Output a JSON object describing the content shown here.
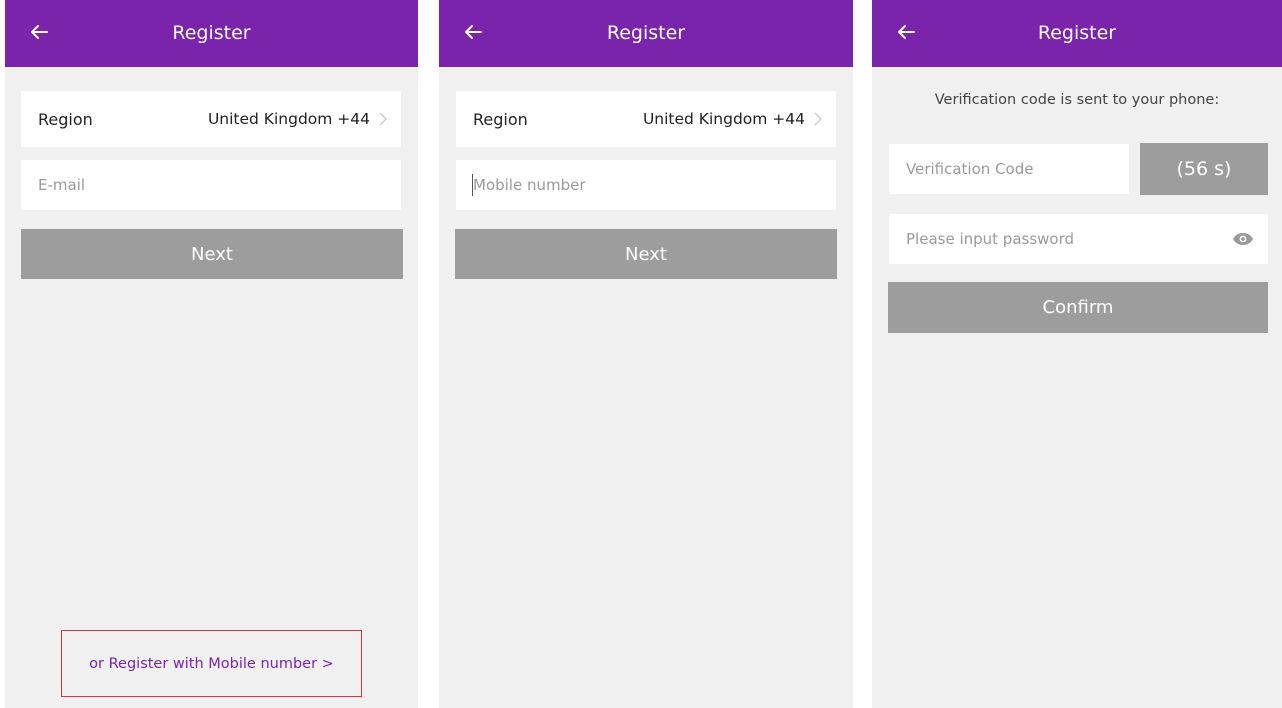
{
  "colors": {
    "appbar": "#7a23ab",
    "background": "#f0f0f0",
    "button_disabled": "#9d9d9d",
    "link": "#7a23ab",
    "highlight_border": "#d6343d"
  },
  "icons": {
    "back": "arrow-left-icon",
    "chevron": "chevron-right-icon",
    "password_toggle": "eye-icon"
  },
  "screens": [
    {
      "title": "Register",
      "region": {
        "label": "Region",
        "value": "United Kingdom +44"
      },
      "email": {
        "placeholder": "E-mail"
      },
      "next_label": "Next",
      "alt_link": "or Register with Mobile number >"
    },
    {
      "title": "Register",
      "region": {
        "label": "Region",
        "value": "United Kingdom +44"
      },
      "mobile": {
        "placeholder": "Mobile number"
      },
      "next_label": "Next"
    },
    {
      "title": "Register",
      "message": "Verification code is sent to your phone:",
      "code": {
        "placeholder": "Verification Code"
      },
      "resend_countdown": "(56 s)",
      "password": {
        "placeholder": "Please input password"
      },
      "confirm_label": "Confirm"
    }
  ]
}
